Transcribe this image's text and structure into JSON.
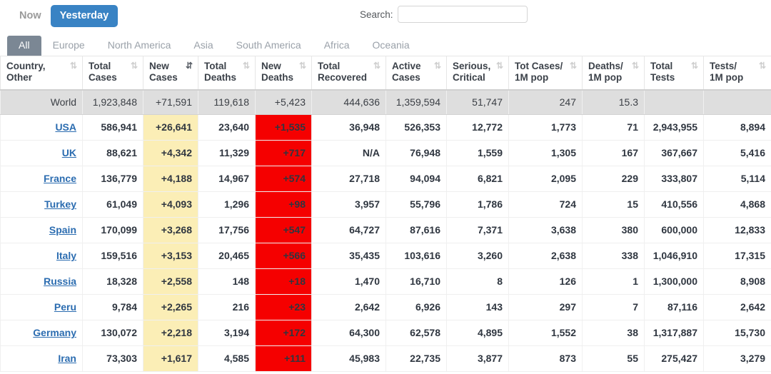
{
  "toolbar": {
    "period_buttons": [
      {
        "label": "Now",
        "active": false
      },
      {
        "label": "Yesterday",
        "active": true
      }
    ],
    "search_label": "Search:",
    "search_value": "",
    "search_placeholder": ""
  },
  "region_tabs": [
    {
      "label": "All",
      "active": true
    },
    {
      "label": "Europe",
      "active": false
    },
    {
      "label": "North America",
      "active": false
    },
    {
      "label": "Asia",
      "active": false
    },
    {
      "label": "South America",
      "active": false
    },
    {
      "label": "Africa",
      "active": false
    },
    {
      "label": "Oceania",
      "active": false
    }
  ],
  "table": {
    "columns": [
      {
        "label": "Country,\nOther",
        "line1": "Country,",
        "line2": "Other",
        "sort": "both"
      },
      {
        "label": "Total Cases",
        "line1": "Total",
        "line2": "Cases",
        "sort": "both"
      },
      {
        "label": "New Cases",
        "line1": "New",
        "line2": "Cases",
        "sort": "desc"
      },
      {
        "label": "Total Deaths",
        "line1": "Total",
        "line2": "Deaths",
        "sort": "both"
      },
      {
        "label": "New Deaths",
        "line1": "New",
        "line2": "Deaths",
        "sort": "both"
      },
      {
        "label": "Total Recovered",
        "line1": "Total",
        "line2": "Recovered",
        "sort": "both"
      },
      {
        "label": "Active Cases",
        "line1": "Active",
        "line2": "Cases",
        "sort": "both"
      },
      {
        "label": "Serious, Critical",
        "line1": "Serious,",
        "line2": "Critical",
        "sort": "both"
      },
      {
        "label": "Tot Cases/1M pop",
        "line1": "Tot Cases/",
        "line2": "1M pop",
        "sort": "both"
      },
      {
        "label": "Deaths/1M pop",
        "line1": "Deaths/",
        "line2": "1M pop",
        "sort": "both"
      },
      {
        "label": "Total Tests",
        "line1": "Total",
        "line2": "Tests",
        "sort": "both"
      },
      {
        "label": "Tests/1M pop",
        "line1": "Tests/",
        "line2": "1M pop",
        "sort": "both"
      }
    ],
    "rows": [
      {
        "country": "World",
        "is_world": true,
        "link": false,
        "total_cases": "1,923,848",
        "new_cases": "+71,591",
        "total_deaths": "119,618",
        "new_deaths": "+5,423",
        "total_recovered": "444,636",
        "active_cases": "1,359,594",
        "serious_critical": "51,747",
        "cases_per_1m": "247",
        "deaths_per_1m": "15.3",
        "total_tests": "",
        "tests_per_1m": ""
      },
      {
        "country": "USA",
        "is_world": false,
        "link": true,
        "total_cases": "586,941",
        "new_cases": "+26,641",
        "total_deaths": "23,640",
        "new_deaths": "+1,535",
        "total_recovered": "36,948",
        "active_cases": "526,353",
        "serious_critical": "12,772",
        "cases_per_1m": "1,773",
        "deaths_per_1m": "71",
        "total_tests": "2,943,955",
        "tests_per_1m": "8,894"
      },
      {
        "country": "UK",
        "is_world": false,
        "link": true,
        "total_cases": "88,621",
        "new_cases": "+4,342",
        "total_deaths": "11,329",
        "new_deaths": "+717",
        "total_recovered": "N/A",
        "active_cases": "76,948",
        "serious_critical": "1,559",
        "cases_per_1m": "1,305",
        "deaths_per_1m": "167",
        "total_tests": "367,667",
        "tests_per_1m": "5,416"
      },
      {
        "country": "France",
        "is_world": false,
        "link": true,
        "total_cases": "136,779",
        "new_cases": "+4,188",
        "total_deaths": "14,967",
        "new_deaths": "+574",
        "total_recovered": "27,718",
        "active_cases": "94,094",
        "serious_critical": "6,821",
        "cases_per_1m": "2,095",
        "deaths_per_1m": "229",
        "total_tests": "333,807",
        "tests_per_1m": "5,114"
      },
      {
        "country": "Turkey",
        "is_world": false,
        "link": true,
        "total_cases": "61,049",
        "new_cases": "+4,093",
        "total_deaths": "1,296",
        "new_deaths": "+98",
        "total_recovered": "3,957",
        "active_cases": "55,796",
        "serious_critical": "1,786",
        "cases_per_1m": "724",
        "deaths_per_1m": "15",
        "total_tests": "410,556",
        "tests_per_1m": "4,868"
      },
      {
        "country": "Spain",
        "is_world": false,
        "link": true,
        "total_cases": "170,099",
        "new_cases": "+3,268",
        "total_deaths": "17,756",
        "new_deaths": "+547",
        "total_recovered": "64,727",
        "active_cases": "87,616",
        "serious_critical": "7,371",
        "cases_per_1m": "3,638",
        "deaths_per_1m": "380",
        "total_tests": "600,000",
        "tests_per_1m": "12,833"
      },
      {
        "country": "Italy",
        "is_world": false,
        "link": true,
        "total_cases": "159,516",
        "new_cases": "+3,153",
        "total_deaths": "20,465",
        "new_deaths": "+566",
        "total_recovered": "35,435",
        "active_cases": "103,616",
        "serious_critical": "3,260",
        "cases_per_1m": "2,638",
        "deaths_per_1m": "338",
        "total_tests": "1,046,910",
        "tests_per_1m": "17,315"
      },
      {
        "country": "Russia",
        "is_world": false,
        "link": true,
        "total_cases": "18,328",
        "new_cases": "+2,558",
        "total_deaths": "148",
        "new_deaths": "+18",
        "total_recovered": "1,470",
        "active_cases": "16,710",
        "serious_critical": "8",
        "cases_per_1m": "126",
        "deaths_per_1m": "1",
        "total_tests": "1,300,000",
        "tests_per_1m": "8,908"
      },
      {
        "country": "Peru",
        "is_world": false,
        "link": true,
        "total_cases": "9,784",
        "new_cases": "+2,265",
        "total_deaths": "216",
        "new_deaths": "+23",
        "total_recovered": "2,642",
        "active_cases": "6,926",
        "serious_critical": "143",
        "cases_per_1m": "297",
        "deaths_per_1m": "7",
        "total_tests": "87,116",
        "tests_per_1m": "2,642"
      },
      {
        "country": "Germany",
        "is_world": false,
        "link": true,
        "total_cases": "130,072",
        "new_cases": "+2,218",
        "total_deaths": "3,194",
        "new_deaths": "+172",
        "total_recovered": "64,300",
        "active_cases": "62,578",
        "serious_critical": "4,895",
        "cases_per_1m": "1,552",
        "deaths_per_1m": "38",
        "total_tests": "1,317,887",
        "tests_per_1m": "15,730"
      },
      {
        "country": "Iran",
        "is_world": false,
        "link": true,
        "total_cases": "73,303",
        "new_cases": "+1,617",
        "total_deaths": "4,585",
        "new_deaths": "+111",
        "total_recovered": "45,983",
        "active_cases": "22,735",
        "serious_critical": "3,877",
        "cases_per_1m": "873",
        "deaths_per_1m": "55",
        "total_tests": "275,427",
        "tests_per_1m": "3,279"
      }
    ]
  },
  "colors": {
    "active_period_bg": "#3983c4",
    "active_tab_bg": "#7b8794",
    "new_cases_bg": "#fbeeb6",
    "new_deaths_bg": "#f50000",
    "world_row_bg": "#dedede",
    "country_link": "#2b6cb0"
  }
}
